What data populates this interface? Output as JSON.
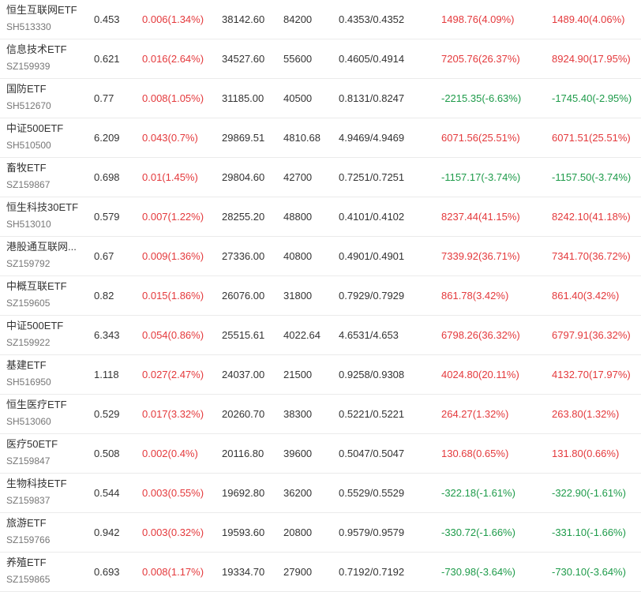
{
  "colors": {
    "up": "#e4393c",
    "down": "#1e9b4a",
    "text": "#333333",
    "code": "#777777"
  },
  "rows": [
    {
      "name": "恒生互联网ETF",
      "code": "SH513330",
      "price": "0.453",
      "change": "0.006(1.34%)",
      "amount": "38142.60",
      "volume": "84200",
      "range": "0.4353/0.4352",
      "pnl1": "1498.76(4.09%)",
      "pnl2": "1489.40(4.06%)"
    },
    {
      "name": "信息技术ETF",
      "code": "SZ159939",
      "price": "0.621",
      "change": "0.016(2.64%)",
      "amount": "34527.60",
      "volume": "55600",
      "range": "0.4605/0.4914",
      "pnl1": "7205.76(26.37%)",
      "pnl2": "8924.90(17.95%)"
    },
    {
      "name": "国防ETF",
      "code": "SH512670",
      "price": "0.77",
      "change": "0.008(1.05%)",
      "amount": "31185.00",
      "volume": "40500",
      "range": "0.8131/0.8247",
      "pnl1": "-2215.35(-6.63%)",
      "pnl2": "-1745.40(-2.95%)"
    },
    {
      "name": "中证500ETF",
      "code": "SH510500",
      "price": "6.209",
      "change": "0.043(0.7%)",
      "amount": "29869.51",
      "volume": "4810.68",
      "range": "4.9469/4.9469",
      "pnl1": "6071.56(25.51%)",
      "pnl2": "6071.51(25.51%)"
    },
    {
      "name": "畜牧ETF",
      "code": "SZ159867",
      "price": "0.698",
      "change": "0.01(1.45%)",
      "amount": "29804.60",
      "volume": "42700",
      "range": "0.7251/0.7251",
      "pnl1": "-1157.17(-3.74%)",
      "pnl2": "-1157.50(-3.74%)"
    },
    {
      "name": "恒生科技30ETF",
      "code": "SH513010",
      "price": "0.579",
      "change": "0.007(1.22%)",
      "amount": "28255.20",
      "volume": "48800",
      "range": "0.4101/0.4102",
      "pnl1": "8237.44(41.15%)",
      "pnl2": "8242.10(41.18%)"
    },
    {
      "name": "港股通互联网...",
      "code": "SZ159792",
      "price": "0.67",
      "change": "0.009(1.36%)",
      "amount": "27336.00",
      "volume": "40800",
      "range": "0.4901/0.4901",
      "pnl1": "7339.92(36.71%)",
      "pnl2": "7341.70(36.72%)"
    },
    {
      "name": "中概互联ETF",
      "code": "SZ159605",
      "price": "0.82",
      "change": "0.015(1.86%)",
      "amount": "26076.00",
      "volume": "31800",
      "range": "0.7929/0.7929",
      "pnl1": "861.78(3.42%)",
      "pnl2": "861.40(3.42%)"
    },
    {
      "name": "中证500ETF",
      "code": "SZ159922",
      "price": "6.343",
      "change": "0.054(0.86%)",
      "amount": "25515.61",
      "volume": "4022.64",
      "range": "4.6531/4.653",
      "pnl1": "6798.26(36.32%)",
      "pnl2": "6797.91(36.32%)"
    },
    {
      "name": "基建ETF",
      "code": "SH516950",
      "price": "1.118",
      "change": "0.027(2.47%)",
      "amount": "24037.00",
      "volume": "21500",
      "range": "0.9258/0.9308",
      "pnl1": "4024.80(20.11%)",
      "pnl2": "4132.70(17.97%)"
    },
    {
      "name": "恒生医疗ETF",
      "code": "SH513060",
      "price": "0.529",
      "change": "0.017(3.32%)",
      "amount": "20260.70",
      "volume": "38300",
      "range": "0.5221/0.5221",
      "pnl1": "264.27(1.32%)",
      "pnl2": "263.80(1.32%)"
    },
    {
      "name": "医疗50ETF",
      "code": "SZ159847",
      "price": "0.508",
      "change": "0.002(0.4%)",
      "amount": "20116.80",
      "volume": "39600",
      "range": "0.5047/0.5047",
      "pnl1": "130.68(0.65%)",
      "pnl2": "131.80(0.66%)"
    },
    {
      "name": "生物科技ETF",
      "code": "SZ159837",
      "price": "0.544",
      "change": "0.003(0.55%)",
      "amount": "19692.80",
      "volume": "36200",
      "range": "0.5529/0.5529",
      "pnl1": "-322.18(-1.61%)",
      "pnl2": "-322.90(-1.61%)"
    },
    {
      "name": "旅游ETF",
      "code": "SZ159766",
      "price": "0.942",
      "change": "0.003(0.32%)",
      "amount": "19593.60",
      "volume": "20800",
      "range": "0.9579/0.9579",
      "pnl1": "-330.72(-1.66%)",
      "pnl2": "-331.10(-1.66%)"
    },
    {
      "name": "养殖ETF",
      "code": "SZ159865",
      "price": "0.693",
      "change": "0.008(1.17%)",
      "amount": "19334.70",
      "volume": "27900",
      "range": "0.7192/0.7192",
      "pnl1": "-730.98(-3.64%)",
      "pnl2": "-730.10(-3.64%)"
    }
  ]
}
